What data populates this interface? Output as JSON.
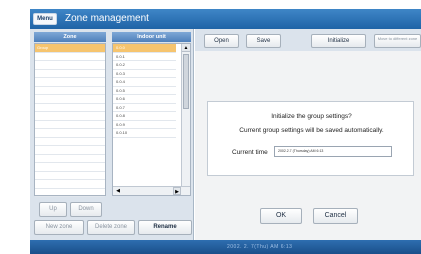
{
  "app": {
    "menu_label": "Menu",
    "title": "Zone management"
  },
  "left": {
    "zone_header": "Zone",
    "unit_header": "Indoor unit",
    "zones": [
      {
        "label": "Group",
        "selected": true
      },
      {
        "label": "",
        "selected": false
      },
      {
        "label": "",
        "selected": false
      },
      {
        "label": "",
        "selected": false
      },
      {
        "label": "",
        "selected": false
      },
      {
        "label": "",
        "selected": false
      },
      {
        "label": "",
        "selected": false
      },
      {
        "label": "",
        "selected": false
      },
      {
        "label": "",
        "selected": false
      },
      {
        "label": "",
        "selected": false
      },
      {
        "label": "",
        "selected": false
      },
      {
        "label": "",
        "selected": false
      },
      {
        "label": "",
        "selected": false
      },
      {
        "label": "",
        "selected": false
      },
      {
        "label": "",
        "selected": false
      },
      {
        "label": "",
        "selected": false
      },
      {
        "label": "",
        "selected": false
      },
      {
        "label": "",
        "selected": false
      }
    ],
    "units": [
      {
        "label": "0.0.0",
        "selected": true
      },
      {
        "label": "0.0.1",
        "selected": false
      },
      {
        "label": "0.0.2",
        "selected": false
      },
      {
        "label": "0.0.3",
        "selected": false
      },
      {
        "label": "0.0.4",
        "selected": false
      },
      {
        "label": "0.0.5",
        "selected": false
      },
      {
        "label": "0.0.6",
        "selected": false
      },
      {
        "label": "0.0.7",
        "selected": false
      },
      {
        "label": "0.0.8",
        "selected": false
      },
      {
        "label": "0.0.9",
        "selected": false
      },
      {
        "label": "0.0.10",
        "selected": false
      }
    ],
    "buttons": {
      "up": "Up",
      "down": "Down",
      "new_zone": "New zone",
      "delete_zone": "Delete zone",
      "rename": "Rename"
    }
  },
  "right": {
    "toolbar": {
      "open": "Open",
      "save": "Save",
      "initialize": "Initialize",
      "move": "Move to different zone"
    },
    "dialog": {
      "line1": "Initialize the group settings?",
      "line2": "Current group settings will be saved automatically.",
      "current_time_label": "Current time",
      "current_time_value": "2002.2.7 (Thursday) AM 6:13"
    },
    "ok": "OK",
    "cancel": "Cancel"
  },
  "status": {
    "time": "2002. 2. 7(Thu) AM 6:13"
  },
  "colors": {
    "titlebar": "#2a72b8",
    "selection": "#f6c46e",
    "panel": "#dbe3ec"
  }
}
